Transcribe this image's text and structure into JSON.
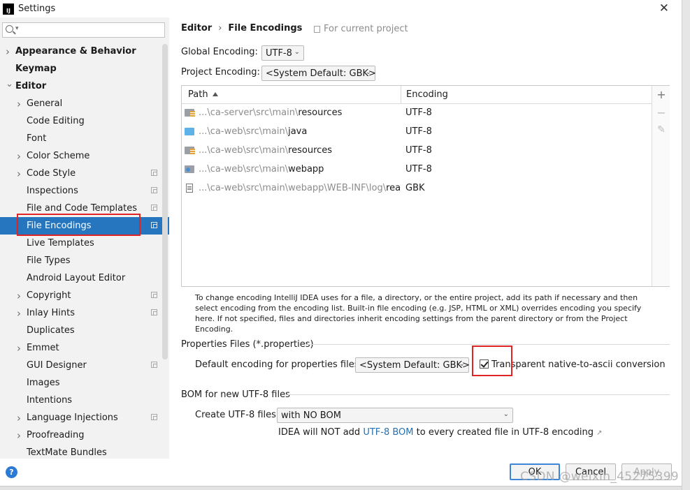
{
  "window": {
    "title": "Settings",
    "icon_text": "IJ"
  },
  "sidebar": {
    "search_placeholder": "",
    "items": [
      {
        "label": "Appearance & Behavior",
        "level": 0,
        "bold": true,
        "expandable": true,
        "expanded": false
      },
      {
        "label": "Keymap",
        "level": 0,
        "bold": true,
        "expandable": false
      },
      {
        "label": "Editor",
        "level": 0,
        "bold": true,
        "expandable": true,
        "expanded": true
      },
      {
        "label": "General",
        "level": 1,
        "expandable": true
      },
      {
        "label": "Code Editing",
        "level": 1
      },
      {
        "label": "Font",
        "level": 1
      },
      {
        "label": "Color Scheme",
        "level": 1,
        "expandable": true
      },
      {
        "label": "Code Style",
        "level": 1,
        "expandable": true,
        "project_icon": true
      },
      {
        "label": "Inspections",
        "level": 1,
        "project_icon": true
      },
      {
        "label": "File and Code Templates",
        "level": 1,
        "project_icon": true
      },
      {
        "label": "File Encodings",
        "level": 1,
        "project_icon": true,
        "selected": true
      },
      {
        "label": "Live Templates",
        "level": 1
      },
      {
        "label": "File Types",
        "level": 1
      },
      {
        "label": "Android Layout Editor",
        "level": 1
      },
      {
        "label": "Copyright",
        "level": 1,
        "expandable": true,
        "project_icon": true
      },
      {
        "label": "Inlay Hints",
        "level": 1,
        "expandable": true,
        "project_icon": true
      },
      {
        "label": "Duplicates",
        "level": 1
      },
      {
        "label": "Emmet",
        "level": 1,
        "expandable": true
      },
      {
        "label": "GUI Designer",
        "level": 1,
        "project_icon": true
      },
      {
        "label": "Images",
        "level": 1
      },
      {
        "label": "Intentions",
        "level": 1
      },
      {
        "label": "Language Injections",
        "level": 1,
        "expandable": true,
        "project_icon": true
      },
      {
        "label": "Proofreading",
        "level": 1,
        "expandable": true
      },
      {
        "label": "TextMate Bundles",
        "level": 1
      }
    ]
  },
  "breadcrumb": {
    "parent": "Editor",
    "separator": "›",
    "current": "File Encodings",
    "scope": "For current project"
  },
  "global_encoding": {
    "label": "Global Encoding:",
    "value": "UTF-8"
  },
  "project_encoding": {
    "label": "Project Encoding:",
    "value": "<System Default: GBK>"
  },
  "table": {
    "col_path": "Path",
    "col_encoding": "Encoding",
    "rows": [
      {
        "icon": "resources-folder",
        "path_dim": "...\\ca-server\\src\\main\\",
        "path_main": "resources",
        "encoding": "UTF-8"
      },
      {
        "icon": "source-folder",
        "path_dim": "...\\ca-web\\src\\main\\",
        "path_main": "java",
        "encoding": "UTF-8"
      },
      {
        "icon": "resources-folder",
        "path_dim": "...\\ca-web\\src\\main\\",
        "path_main": "resources",
        "encoding": "UTF-8"
      },
      {
        "icon": "web-folder",
        "path_dim": "...\\ca-web\\src\\main\\",
        "path_main": "webapp",
        "encoding": "UTF-8"
      },
      {
        "icon": "text-file",
        "path_dim": "...\\ca-web\\src\\main\\webapp\\WEB-INF\\log\\",
        "path_main": "readme",
        "encoding": "GBK"
      }
    ],
    "tools": [
      "+",
      "−",
      "✎"
    ]
  },
  "info_text": "To change encoding IntelliJ IDEA uses for a file, a directory, or the entire project, add its path if necessary and then select encoding from the encoding list. Built-in file encoding (e.g. JSP, HTML or XML) overrides encoding you specify here. If not specified, files and directories inherit encoding settings from the parent directory or from the Project Encoding.",
  "properties": {
    "section_title": "Properties Files (*.properties)",
    "default_label": "Default encoding for properties files:",
    "default_value": "<System Default: GBK>",
    "transparent_label": "Transparent native-to-ascii conversion",
    "transparent_checked": true
  },
  "bom": {
    "section_title": "BOM for new UTF-8 files",
    "create_label": "Create UTF-8 files:",
    "create_value": "with NO BOM",
    "note_before": "IDEA will NOT add ",
    "note_link": "UTF-8 BOM",
    "note_after": " to every created file in UTF-8 encoding",
    "note_arrow": "↗"
  },
  "footer": {
    "help": "?",
    "ok": "OK",
    "cancel": "Cancel",
    "apply": "Apply"
  },
  "watermark": "CSDN @weixin_45275399",
  "colors": {
    "selection": "#2675bf",
    "highlight_box": "#e02424",
    "link": "#2470b3",
    "sidebar_bg": "#f2f2f2"
  }
}
